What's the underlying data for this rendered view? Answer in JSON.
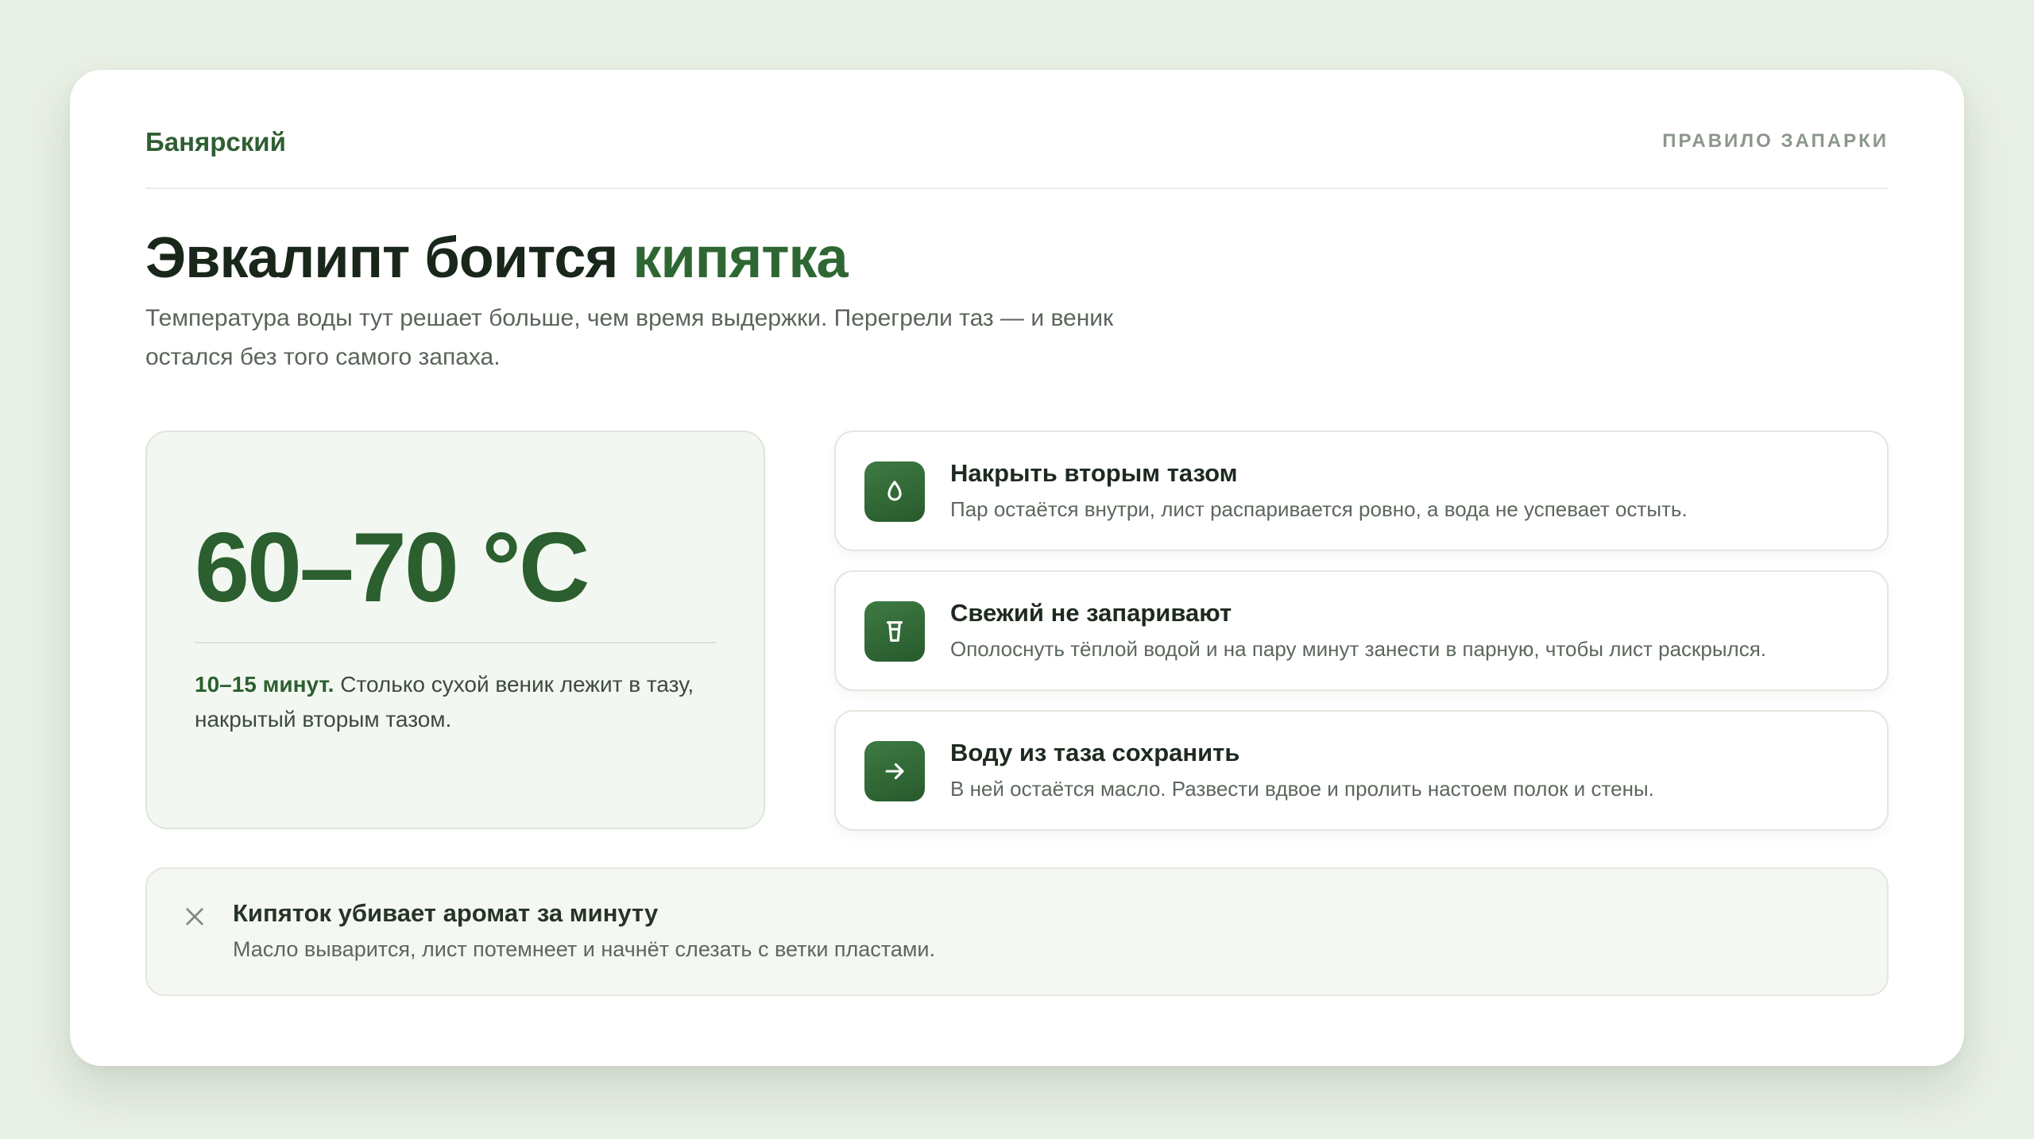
{
  "header": {
    "brand": "Банярский",
    "rule_label": "ПРАВИЛО ЗАПАРКИ"
  },
  "hero": {
    "title_main": "Эвкалипт боится ",
    "title_accent": "кипятка",
    "subtitle": "Температура воды тут решает больше, чем время выдержки. Перегрели таз — и веник остался без того самого запаха."
  },
  "temperature": {
    "value": "60–70 °C",
    "time_strong": "10–15 минут.",
    "time_text": " Столько сухой веник лежит в тазу, накрытый вторым тазом."
  },
  "steps": [
    {
      "icon": "water-drop-icon",
      "title": "Накрыть вторым тазом",
      "desc": "Пар остаётся внутри, лист распаривается ровно, а вода не успевает остыть."
    },
    {
      "icon": "cup-icon",
      "title": "Свежий не запаривают",
      "desc": "Ополоснуть тёплой водой и на пару минут занести в парную, чтобы лист раскрылся."
    },
    {
      "icon": "arrow-right-icon",
      "title": "Воду из таза сохранить",
      "desc": "В ней остаётся масло. Развести вдвое и пролить настоем полок и стены."
    }
  ],
  "warning": {
    "icon": "close-icon",
    "title": "Кипяток убивает аромат за минуту",
    "desc": "Масло выварится, лист потемнеет и начнёт слезать с ветки пластами."
  },
  "colors": {
    "accent": "#2e6733",
    "background": "#e9f0e6",
    "card": "#ffffff"
  }
}
